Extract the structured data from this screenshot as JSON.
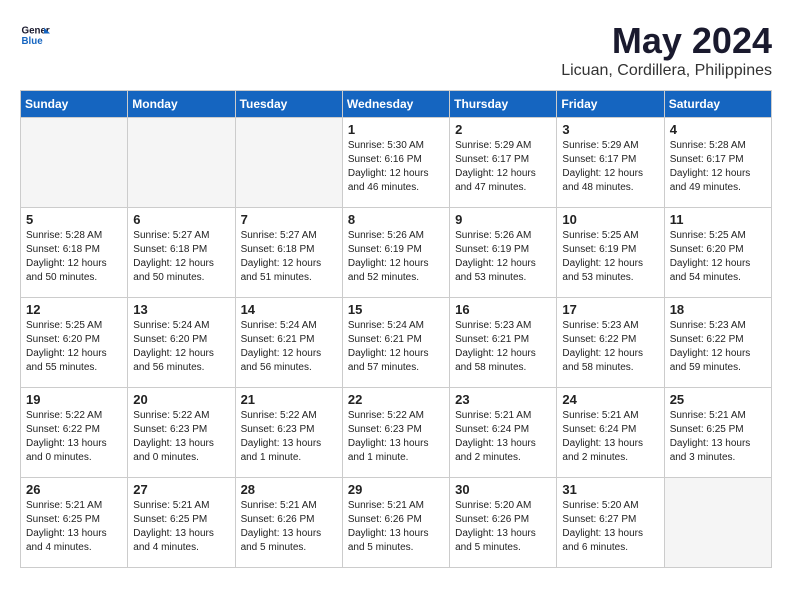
{
  "header": {
    "logo_line1": "General",
    "logo_line2": "Blue",
    "month": "May 2024",
    "location": "Licuan, Cordillera, Philippines"
  },
  "weekdays": [
    "Sunday",
    "Monday",
    "Tuesday",
    "Wednesday",
    "Thursday",
    "Friday",
    "Saturday"
  ],
  "weeks": [
    [
      {
        "day": "",
        "info": ""
      },
      {
        "day": "",
        "info": ""
      },
      {
        "day": "",
        "info": ""
      },
      {
        "day": "1",
        "info": "Sunrise: 5:30 AM\nSunset: 6:16 PM\nDaylight: 12 hours\nand 46 minutes."
      },
      {
        "day": "2",
        "info": "Sunrise: 5:29 AM\nSunset: 6:17 PM\nDaylight: 12 hours\nand 47 minutes."
      },
      {
        "day": "3",
        "info": "Sunrise: 5:29 AM\nSunset: 6:17 PM\nDaylight: 12 hours\nand 48 minutes."
      },
      {
        "day": "4",
        "info": "Sunrise: 5:28 AM\nSunset: 6:17 PM\nDaylight: 12 hours\nand 49 minutes."
      }
    ],
    [
      {
        "day": "5",
        "info": "Sunrise: 5:28 AM\nSunset: 6:18 PM\nDaylight: 12 hours\nand 50 minutes."
      },
      {
        "day": "6",
        "info": "Sunrise: 5:27 AM\nSunset: 6:18 PM\nDaylight: 12 hours\nand 50 minutes."
      },
      {
        "day": "7",
        "info": "Sunrise: 5:27 AM\nSunset: 6:18 PM\nDaylight: 12 hours\nand 51 minutes."
      },
      {
        "day": "8",
        "info": "Sunrise: 5:26 AM\nSunset: 6:19 PM\nDaylight: 12 hours\nand 52 minutes."
      },
      {
        "day": "9",
        "info": "Sunrise: 5:26 AM\nSunset: 6:19 PM\nDaylight: 12 hours\nand 53 minutes."
      },
      {
        "day": "10",
        "info": "Sunrise: 5:25 AM\nSunset: 6:19 PM\nDaylight: 12 hours\nand 53 minutes."
      },
      {
        "day": "11",
        "info": "Sunrise: 5:25 AM\nSunset: 6:20 PM\nDaylight: 12 hours\nand 54 minutes."
      }
    ],
    [
      {
        "day": "12",
        "info": "Sunrise: 5:25 AM\nSunset: 6:20 PM\nDaylight: 12 hours\nand 55 minutes."
      },
      {
        "day": "13",
        "info": "Sunrise: 5:24 AM\nSunset: 6:20 PM\nDaylight: 12 hours\nand 56 minutes."
      },
      {
        "day": "14",
        "info": "Sunrise: 5:24 AM\nSunset: 6:21 PM\nDaylight: 12 hours\nand 56 minutes."
      },
      {
        "day": "15",
        "info": "Sunrise: 5:24 AM\nSunset: 6:21 PM\nDaylight: 12 hours\nand 57 minutes."
      },
      {
        "day": "16",
        "info": "Sunrise: 5:23 AM\nSunset: 6:21 PM\nDaylight: 12 hours\nand 58 minutes."
      },
      {
        "day": "17",
        "info": "Sunrise: 5:23 AM\nSunset: 6:22 PM\nDaylight: 12 hours\nand 58 minutes."
      },
      {
        "day": "18",
        "info": "Sunrise: 5:23 AM\nSunset: 6:22 PM\nDaylight: 12 hours\nand 59 minutes."
      }
    ],
    [
      {
        "day": "19",
        "info": "Sunrise: 5:22 AM\nSunset: 6:22 PM\nDaylight: 13 hours\nand 0 minutes."
      },
      {
        "day": "20",
        "info": "Sunrise: 5:22 AM\nSunset: 6:23 PM\nDaylight: 13 hours\nand 0 minutes."
      },
      {
        "day": "21",
        "info": "Sunrise: 5:22 AM\nSunset: 6:23 PM\nDaylight: 13 hours\nand 1 minute."
      },
      {
        "day": "22",
        "info": "Sunrise: 5:22 AM\nSunset: 6:23 PM\nDaylight: 13 hours\nand 1 minute."
      },
      {
        "day": "23",
        "info": "Sunrise: 5:21 AM\nSunset: 6:24 PM\nDaylight: 13 hours\nand 2 minutes."
      },
      {
        "day": "24",
        "info": "Sunrise: 5:21 AM\nSunset: 6:24 PM\nDaylight: 13 hours\nand 2 minutes."
      },
      {
        "day": "25",
        "info": "Sunrise: 5:21 AM\nSunset: 6:25 PM\nDaylight: 13 hours\nand 3 minutes."
      }
    ],
    [
      {
        "day": "26",
        "info": "Sunrise: 5:21 AM\nSunset: 6:25 PM\nDaylight: 13 hours\nand 4 minutes."
      },
      {
        "day": "27",
        "info": "Sunrise: 5:21 AM\nSunset: 6:25 PM\nDaylight: 13 hours\nand 4 minutes."
      },
      {
        "day": "28",
        "info": "Sunrise: 5:21 AM\nSunset: 6:26 PM\nDaylight: 13 hours\nand 5 minutes."
      },
      {
        "day": "29",
        "info": "Sunrise: 5:21 AM\nSunset: 6:26 PM\nDaylight: 13 hours\nand 5 minutes."
      },
      {
        "day": "30",
        "info": "Sunrise: 5:20 AM\nSunset: 6:26 PM\nDaylight: 13 hours\nand 5 minutes."
      },
      {
        "day": "31",
        "info": "Sunrise: 5:20 AM\nSunset: 6:27 PM\nDaylight: 13 hours\nand 6 minutes."
      },
      {
        "day": "",
        "info": ""
      }
    ]
  ]
}
